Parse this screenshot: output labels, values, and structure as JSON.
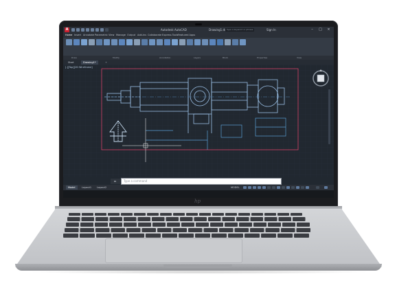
{
  "app": {
    "logo_letter": "A",
    "title": "Autodesk AutoCAD",
    "document": "Drawing1.dwg",
    "search_placeholder": "Type a keyword or phrase",
    "signin": "Sign In"
  },
  "menu": {
    "items": [
      "Home",
      "Insert",
      "Annotate",
      "Parametric",
      "View",
      "Manage",
      "Output",
      "Add-ins",
      "Collaborate",
      "Express Tools",
      "Featured Apps"
    ],
    "active": "Home"
  },
  "ribbon": {
    "tools": [
      "Line",
      "Polyline",
      "Circle",
      "Arc",
      "Move",
      "Copy",
      "Stretch",
      "Rotate",
      "Mirror",
      "Fillet",
      "Trim",
      "Scale",
      "Array",
      "Erase",
      "Explode",
      "Offset",
      "Text",
      "Dimension",
      "Layer Properties",
      "Insert",
      "Group",
      "Utilities",
      "Clipboard",
      "View"
    ],
    "panels": [
      "Draw",
      "Modify",
      "Annotation",
      "Layers",
      "Block",
      "Properties",
      "Groups",
      "Utilities",
      "Clipboard",
      "View"
    ]
  },
  "tabs": {
    "start": "Start",
    "drawing": "Drawing1*"
  },
  "viewport_label": "[-][Top][2D Wireframe]",
  "command_line": {
    "prefix": "►",
    "value": "Type a command"
  },
  "status": {
    "layouts": [
      "Model",
      "Layout1",
      "Layout2"
    ],
    "active_layout": "Model",
    "mode": "MODEL"
  },
  "brand_logo": "hp",
  "colors": {
    "accent": "#4a78b0",
    "drawing_lines": "#8fb3d9",
    "drawing_border": "#d9436a",
    "canvas": "#212830"
  }
}
